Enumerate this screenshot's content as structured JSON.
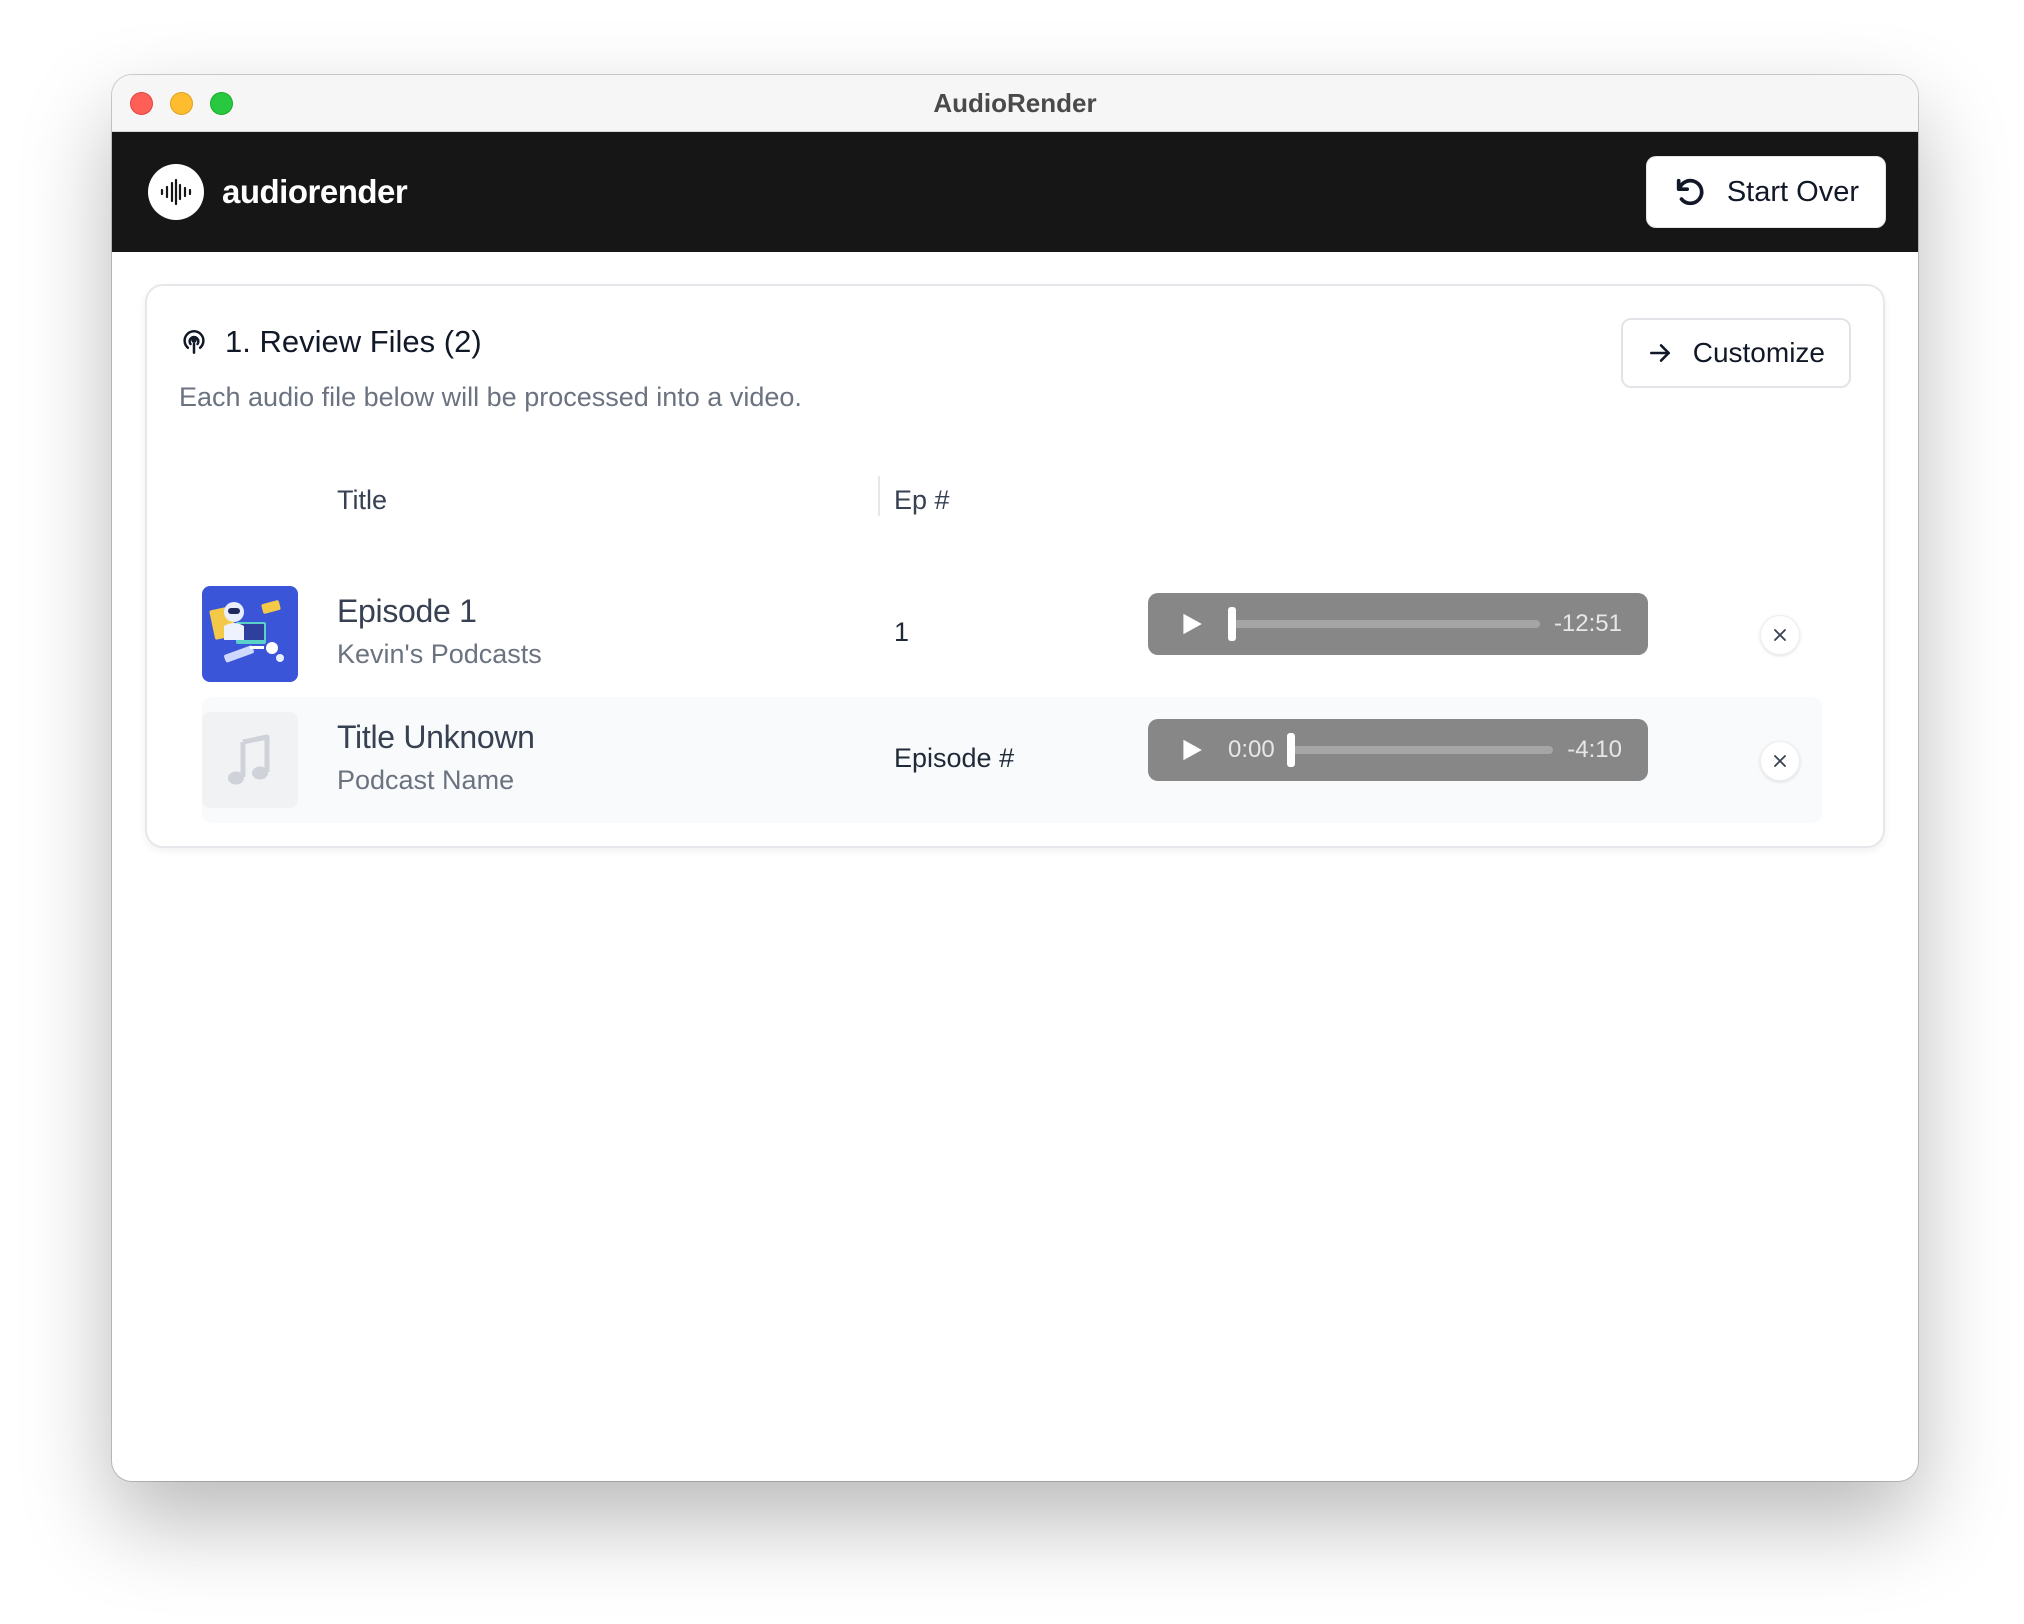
{
  "window": {
    "title": "AudioRender"
  },
  "header": {
    "brand_name": "audiorender",
    "start_over_label": "Start Over"
  },
  "card": {
    "title": "1. Review Files (2)",
    "subtitle": "Each audio file below will be processed into a video.",
    "customize_label": "Customize"
  },
  "table": {
    "columns": {
      "title": "Title",
      "ep": "Ep #"
    },
    "rows": [
      {
        "title": "Episode 1",
        "podcast": "Kevin's Podcasts",
        "episode": "1",
        "current_time": "",
        "remaining_time": "-12:51",
        "progress": 0
      },
      {
        "title": "Title Unknown",
        "podcast": "Podcast Name",
        "episode": "Episode #",
        "current_time": "0:00",
        "remaining_time": "-4:10",
        "progress": 0
      }
    ]
  },
  "colors": {
    "header_bg": "#161616",
    "player_bg": "#878787",
    "thumb_bg": "#3b55d9"
  },
  "icons": [
    "waveform-icon",
    "undo-icon",
    "podcast-icon",
    "arrow-right-icon",
    "play-icon",
    "close-icon",
    "music-note-icon"
  ]
}
